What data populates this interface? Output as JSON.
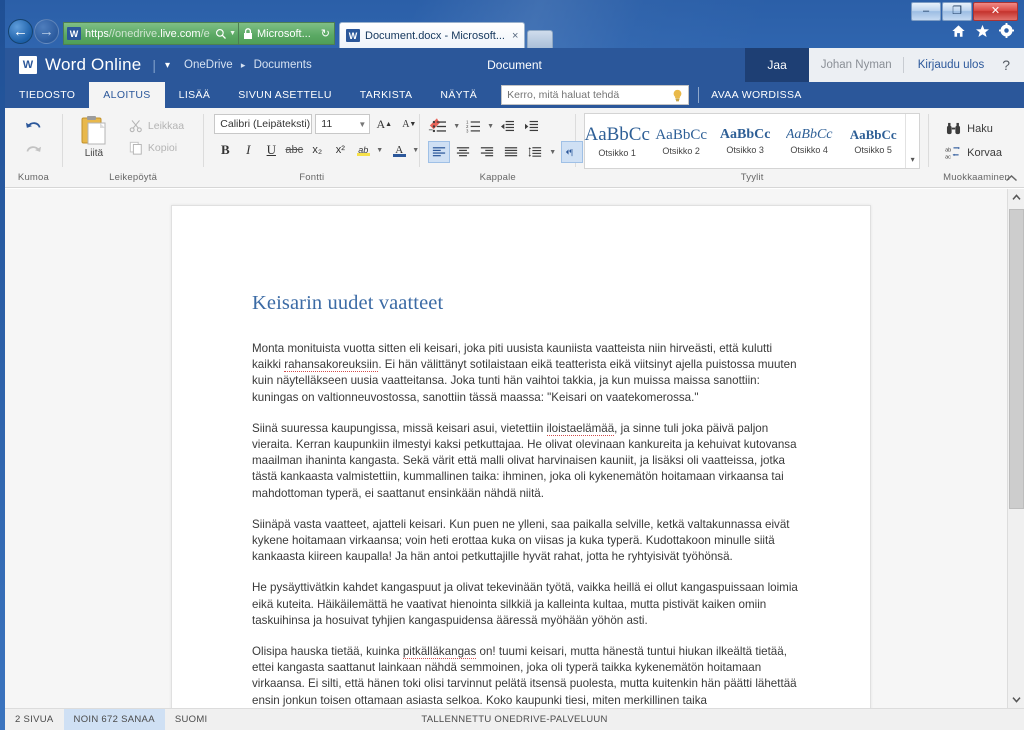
{
  "browser": {
    "nav": {
      "back_label": "←",
      "forward_label": "→"
    },
    "address": {
      "scheme": "https",
      "sep": "//",
      "host_dim": "onedrive",
      "host_strong": ".live.com",
      "path_dim": "/e",
      "search_icon": "search-icon",
      "dropdown_icon": "chevron-down-icon"
    },
    "security_chip": {
      "lock_icon": "lock-icon",
      "label": "Microsoft...",
      "refresh_icon": "refresh-icon"
    },
    "tab": {
      "favicon": "W",
      "title": "Document.docx - Microsoft...",
      "close_label": "×"
    },
    "ie_icons": {
      "home": "home-icon",
      "favorites": "star-icon",
      "tools": "gear-icon"
    },
    "window_buttons": {
      "minimize": "–",
      "maximize": "❐",
      "close": "✕"
    }
  },
  "app_header": {
    "logo_letter": "W",
    "title": "Word Online",
    "divider": "|",
    "caret": "▾",
    "breadcrumb": {
      "root": "OneDrive",
      "sep": "▸",
      "folder": "Documents"
    },
    "doc_name": "Document",
    "share_label": "Jaa",
    "user_name": "Johan Nyman",
    "sign_out_label": "Kirjaudu ulos",
    "help_label": "?"
  },
  "ribbon_tabs": {
    "tabs": [
      {
        "label": "TIEDOSTO",
        "active": false
      },
      {
        "label": "ALOITUS",
        "active": true
      },
      {
        "label": "LISÄÄ",
        "active": false
      },
      {
        "label": "SIVUN ASETTELU",
        "active": false
      },
      {
        "label": "TARKISTA",
        "active": false
      },
      {
        "label": "NÄYTÄ",
        "active": false
      }
    ],
    "tell_me_placeholder": "Kerro, mitä haluat tehdä",
    "tell_me_value": "",
    "open_in_word_label": "AVAA WORDISSA"
  },
  "ribbon": {
    "undo_group": {
      "label": "Kumoa",
      "undo_icon": "undo-arrow-icon",
      "redo_icon": "redo-arrow-icon"
    },
    "clipboard_group": {
      "label": "Leikepöytä",
      "paste_label": "Liitä",
      "paste_icon": "clipboard-paste-icon",
      "cut_label": "Leikkaa",
      "cut_icon": "scissors-icon",
      "copy_label": "Kopioi",
      "copy_icon": "copy-icon"
    },
    "font_group": {
      "label": "Fontti",
      "font_name": "Calibri (Leipäteksti)",
      "font_size": "11",
      "grow_font_label": "A",
      "shrink_font_label": "A",
      "clear_format_icon": "clear-formatting-icon",
      "bold_label": "B",
      "italic_label": "I",
      "underline_label": "U",
      "strikethrough_label": "abc",
      "subscript_label": "x₂",
      "superscript_label": "x²",
      "highlight_label": "ab",
      "font_color_label": "A",
      "highlight_color": "#f7e14a",
      "font_color": "#2b579a"
    },
    "paragraph_group": {
      "label": "Kappale",
      "bullets_icon": "bulleted-list-icon",
      "numbering_icon": "numbered-list-icon",
      "decrease_indent_icon": "decrease-indent-icon",
      "increase_indent_icon": "increase-indent-icon",
      "align_left_icon": "align-left-icon",
      "align_center_icon": "align-center-icon",
      "align_right_icon": "align-right-icon",
      "align_justify_icon": "align-justify-icon",
      "line_spacing_icon": "line-spacing-icon",
      "ltr_icon": "left-to-right-icon",
      "rtl_icon": "right-to-left-icon"
    },
    "styles_group": {
      "label": "Tyylit",
      "styles": [
        {
          "sample": "AaBbCс",
          "name": "Otsikko 1",
          "size": "19px",
          "weight": "400",
          "style": "normal"
        },
        {
          "sample": "AaBbCc",
          "name": "Otsikko 2",
          "size": "15px",
          "weight": "400",
          "style": "normal"
        },
        {
          "sample": "AaBbCc",
          "name": "Otsikko 3",
          "size": "14px",
          "weight": "600",
          "style": "normal"
        },
        {
          "sample": "AaBbCc",
          "name": "Otsikko 4",
          "size": "14px",
          "weight": "400",
          "style": "italic"
        },
        {
          "sample": "AaBbCc",
          "name": "Otsikko 5",
          "size": "13px",
          "weight": "600",
          "style": "normal"
        }
      ],
      "more_caret": "▾"
    },
    "editing_group": {
      "label": "Muokkaaminen",
      "find_label": "Haku",
      "find_icon": "binoculars-icon",
      "replace_label": "Korvaa",
      "replace_icon": "replace-icon"
    },
    "collapse_caret": "⌃"
  },
  "document": {
    "title": "Keisarin uudet vaatteet",
    "paragraphs": [
      "Monta monituista vuotta sitten eli keisari, joka piti uusista kauniista vaatteista niin hirveästi, että kulutti kaikki rahansakoreuksiin. Ei hän välittänyt sotilaistaan eikä teatterista eikä viitsinyt ajella puistossa muuten kuin näytelläkseen uusia vaatteitansa. Joka tunti hän vaihtoi takkia, ja kun muissa maissa sanottiin: kuningas on valtionneuvostossa, sanottiin tässä maassa: \"Keisari on vaatekomerossa.\"",
      "Siinä suuressa kaupungissa, missä keisari asui, vietettiin iloistaelämää, ja sinne tuli joka päivä paljon vieraita. Kerran kaupunkiin ilmestyi kaksi petkuttajaa. He olivat olevinaan kankureita ja kehuivat kutovansa maailman ihaninta kangasta. Sekä värit että malli olivat harvinaisen kauniit, ja lisäksi oli vaatteissa, jotka tästä kankaasta valmistettiin, kummallinen taika: ihminen, joka oli kykenemätön hoitamaan virkaansa tai mahdottoman typerä, ei saattanut ensinkään nähdä niitä.",
      "Siinäpä vasta vaatteet, ajatteli keisari. Kun puen ne ylleni, saa paikalla selville, ketkä valtakunnassa eivät kykene hoitamaan virkaansa; voin heti erottaa kuka on viisas ja kuka typerä. Kudottakoon minulle siitä kankaasta kiireen kaupalla! Ja hän antoi petkuttajille hyvät rahat, jotta he ryhtyisivät työhönsä.",
      "He pysäyttivätkin kahdet kangaspuut ja olivat tekevinään työtä, vaikka heillä ei ollut kangaspuissaan loimia eikä kuteita. Häikäilemättä he vaativat hienointa silkkiä ja kalleinta kultaa, mutta pistivät kaiken omiin taskuihinsa ja hosuivat tyhjien kangaspuidensa ääressä myöhään yöhön asti.",
      "Olisipa hauska tietää, kuinka pitkälläkangas on! tuumi keisari, mutta hänestä tuntui hiukan ilkeältä tietää, ettei kangasta saattanut lainkaan nähdä semmoinen, joka oli typerä taikka kykenemätön hoitamaan virkaansa. Ei silti, että hänen toki olisi tarvinnut pelätä itsensä puolesta, mutta kuitenkin hän päätti lähettää ensin jonkun toisen ottamaan asiasta selkoa. Koko kaupunki tiesi, miten merkillinen taika"
    ],
    "spellcheck_words": [
      "rahansakoreuksiin",
      "iloistaelämää",
      "pitkälläkangas"
    ]
  },
  "scrollbar": {
    "up_caret": "⌃",
    "down_caret": "⌄"
  },
  "status_bar": {
    "pages": "2 SIVUA",
    "words": "NOIN 672 SANAA",
    "language": "SUOMI",
    "saved": "TALLENNETTU ONEDRIVE-PALVELUUN"
  },
  "colors": {
    "word_blue": "#2b579a",
    "ribbon_bg": "#f4f4f4",
    "heading_blue": "#3c6ba5",
    "selection_blue": "#cfe0f4"
  }
}
